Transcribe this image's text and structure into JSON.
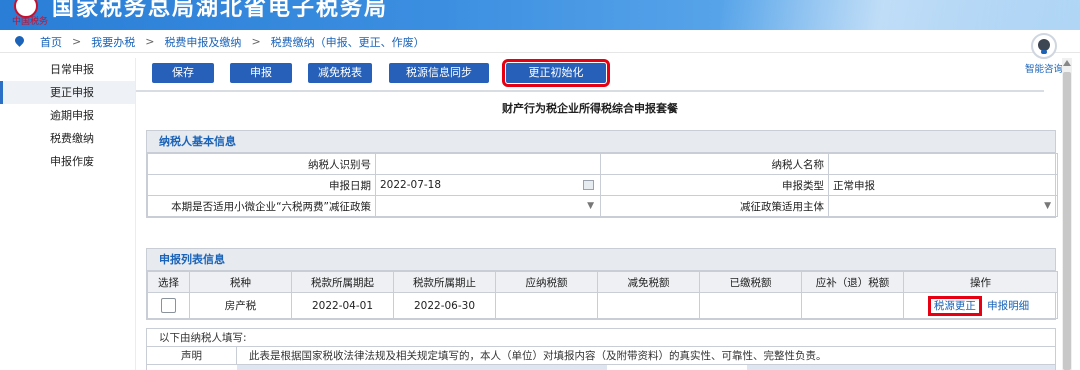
{
  "banner": {
    "title": "国家税务总局湖北省电子税务局",
    "logo_sub": "中国税务"
  },
  "breadcrumb": [
    "首页",
    "我要办税",
    "税费申报及缴纳",
    "税费缴纳（申报、更正、作废）"
  ],
  "sidebar": {
    "items": [
      {
        "label": "日常申报"
      },
      {
        "label": "更正申报"
      },
      {
        "label": "逾期申报"
      },
      {
        "label": "税费缴纳"
      },
      {
        "label": "申报作废"
      }
    ]
  },
  "toolbar": {
    "save": "保存",
    "declare": "申报",
    "reduce": "减免税表",
    "sync": "税源信息同步",
    "init": "更正初始化"
  },
  "assist": {
    "label": "智能咨询"
  },
  "page_title": "财产行为税企业所得税综合申报套餐",
  "basic": {
    "header": "纳税人基本信息",
    "taxpayer_id_label": "纳税人识别号",
    "taxpayer_id_value": "",
    "taxpayer_name_label": "纳税人名称",
    "taxpayer_name_value": "",
    "date_label": "申报日期",
    "date_value": "2022-07-18",
    "type_label": "申报类型",
    "type_value": "正常申报",
    "policy_label": "本期是否适用小微企业“六税两费”减征政策",
    "subject_label": "减征政策适用主体"
  },
  "list": {
    "header": "申报列表信息",
    "columns": [
      "选择",
      "税种",
      "税款所属期起",
      "税款所属期止",
      "应纳税额",
      "减免税额",
      "已缴税额",
      "应补（退）税额",
      "操作"
    ],
    "rows": [
      {
        "tax": "房产税",
        "start": "2022-04-01",
        "end": "2022-06-30",
        "payable": "",
        "reduced": "",
        "paid": "",
        "due": "",
        "op1": "税源更正",
        "op2": "申报明细"
      }
    ]
  },
  "note": {
    "line1": "以下由纳税人填写:",
    "statement_key": "声明",
    "statement_text": "此表是根据国家税收法律法规及相关规定填写的，本人（单位）对填报内容（及附带资料）的真实性、可靠性、完整性负责。"
  },
  "colors": {
    "brand_blue": "#2660b8",
    "highlight_red": "#e60012",
    "link_blue": "#1a63b8"
  }
}
